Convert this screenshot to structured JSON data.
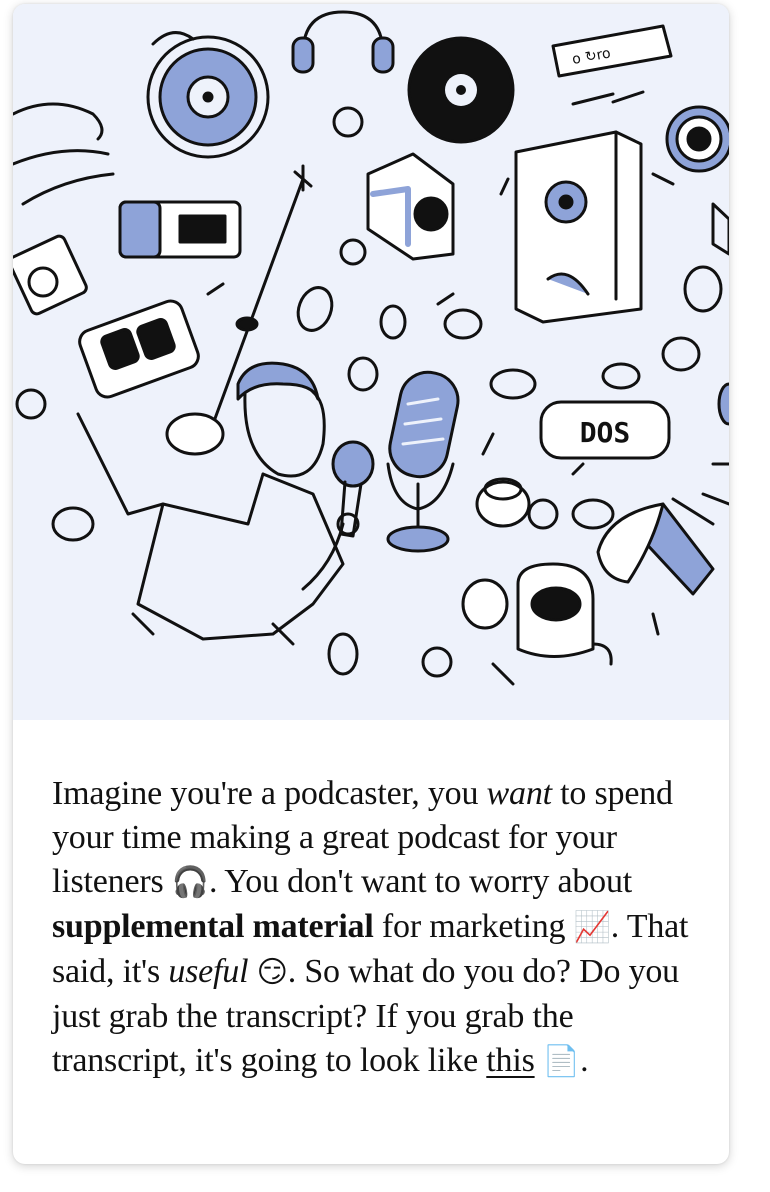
{
  "hero": {
    "label_tape": "o ↻ro",
    "label_box": "DOS",
    "colors": {
      "background": "#eef2fb",
      "accent": "#8ea3d8",
      "ink": "#111111"
    },
    "icons": [
      "headphones-icon",
      "vinyl-record-icon",
      "speaker-icon",
      "microphone-icon",
      "podcaster-person-icon",
      "cassette-icon",
      "megaphone-icon",
      "camera-icon"
    ]
  },
  "story": {
    "t1": "Imagine you're a podcaster, you ",
    "t2": "want",
    "t3": " to spend your time making a great podcast for your listeners ",
    "e1": "🎧",
    "t4": ". You don't want to worry about ",
    "t5": "supplemental material",
    "t6": " for marketing ",
    "e2": "📈",
    "t7": ". That said, it's ",
    "t8": "useful",
    "t9": " ",
    "e3": "😏",
    "t10": ". So what do you do? Do you just grab the transcript? If you grab the transcript, it's going to look like ",
    "link": "this",
    "t11": " ",
    "e4": "📄",
    "t12": "."
  }
}
